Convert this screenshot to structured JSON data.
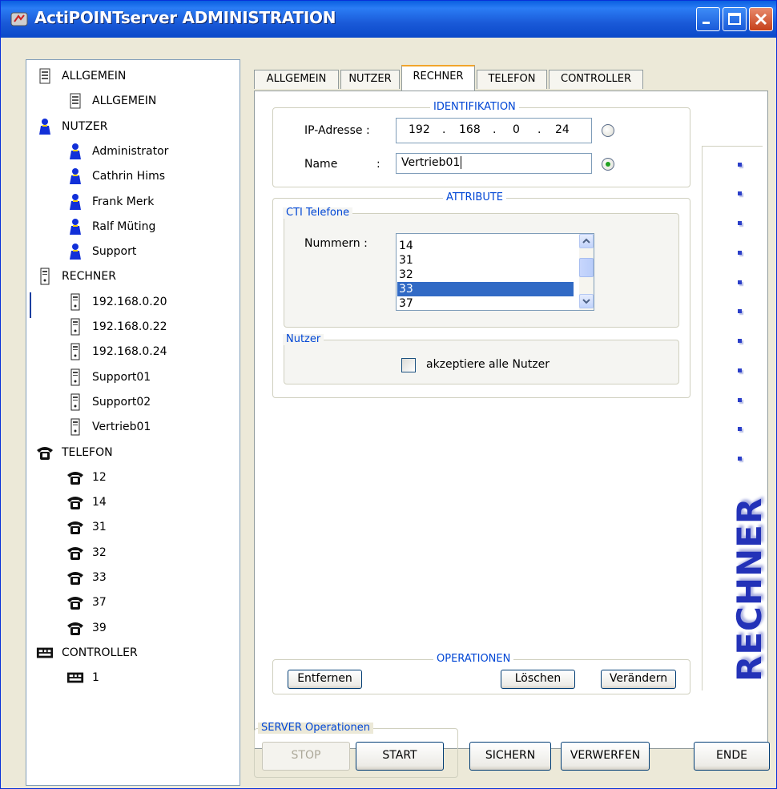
{
  "window": {
    "title": "ActiPOINTserver ADMINISTRATION",
    "title_color": "#0a5fe0"
  },
  "tree": {
    "nodes": [
      {
        "label": "ALLGEMEIN",
        "icon": "device-icon",
        "level": 0
      },
      {
        "label": "ALLGEMEIN",
        "icon": "device-icon",
        "level": 1
      },
      {
        "label": "NUTZER",
        "icon": "user-icon",
        "level": 0
      },
      {
        "label": "Administrator",
        "icon": "user-icon",
        "level": 1
      },
      {
        "label": "Cathrin Hims",
        "icon": "user-icon",
        "level": 1
      },
      {
        "label": "Frank Merk",
        "icon": "user-icon",
        "level": 1
      },
      {
        "label": "Ralf Müting",
        "icon": "user-icon",
        "level": 1
      },
      {
        "label": "Support",
        "icon": "user-icon",
        "level": 1
      },
      {
        "label": "RECHNER",
        "icon": "computer-icon",
        "level": 0
      },
      {
        "label": "192.168.0.20",
        "icon": "computer-icon",
        "level": 1
      },
      {
        "label": "192.168.0.22",
        "icon": "computer-icon",
        "level": 1
      },
      {
        "label": "192.168.0.24",
        "icon": "computer-icon",
        "level": 1
      },
      {
        "label": "Support01",
        "icon": "computer-icon",
        "level": 1
      },
      {
        "label": "Support02",
        "icon": "computer-icon",
        "level": 1
      },
      {
        "label": "Vertrieb01",
        "icon": "computer-icon",
        "level": 1
      },
      {
        "label": "TELEFON",
        "icon": "phone-icon",
        "level": 0
      },
      {
        "label": "12",
        "icon": "phone-icon",
        "level": 1
      },
      {
        "label": "14",
        "icon": "phone-icon",
        "level": 1
      },
      {
        "label": "31",
        "icon": "phone-icon",
        "level": 1
      },
      {
        "label": "32",
        "icon": "phone-icon",
        "level": 1
      },
      {
        "label": "33",
        "icon": "phone-icon",
        "level": 1
      },
      {
        "label": "37",
        "icon": "phone-icon",
        "level": 1
      },
      {
        "label": "39",
        "icon": "phone-icon",
        "level": 1
      },
      {
        "label": "CONTROLLER",
        "icon": "controller-icon",
        "level": 0
      },
      {
        "label": "1",
        "icon": "controller-icon",
        "level": 1
      }
    ]
  },
  "tabs": [
    "ALLGEMEIN",
    "NUTZER",
    "RECHNER",
    "TELEFON",
    "CONTROLLER"
  ],
  "active_tab": "RECHNER",
  "identifikation": {
    "title": "IDENTIFIKATION",
    "ip_label": "IP-Adresse :",
    "ip": [
      "192",
      "168",
      "0",
      "24"
    ],
    "ip_dot": ".",
    "name_label": "Name",
    "name_colon": ":",
    "name_value": "Vertrieb01"
  },
  "attribute": {
    "title": "ATTRIBUTE",
    "cti_title": "CTI Telefone",
    "nummern_label": "Nummern  :",
    "numbers": [
      "14",
      "31",
      "32",
      "33",
      "37"
    ],
    "selected_number": "33",
    "nutzer_title": "Nutzer",
    "accept_all_label": "akzeptiere alle Nutzer",
    "accept_all_checked": false
  },
  "operationen": {
    "title": "OPERATIONEN",
    "remove_label": "Entfernen",
    "delete_label": "Löschen",
    "change_label": "Verändern"
  },
  "banner": {
    "word": "RECHNER",
    "color": "#2332b8"
  },
  "server": {
    "title": "SERVER Operationen",
    "stop_label": "STOP",
    "start_label": "START"
  },
  "bottom": {
    "save_label": "SICHERN",
    "discard_label": "VERWERFEN",
    "end_label": "ENDE"
  },
  "accent_color": "#0046d5",
  "selection_color": "#316ac5"
}
